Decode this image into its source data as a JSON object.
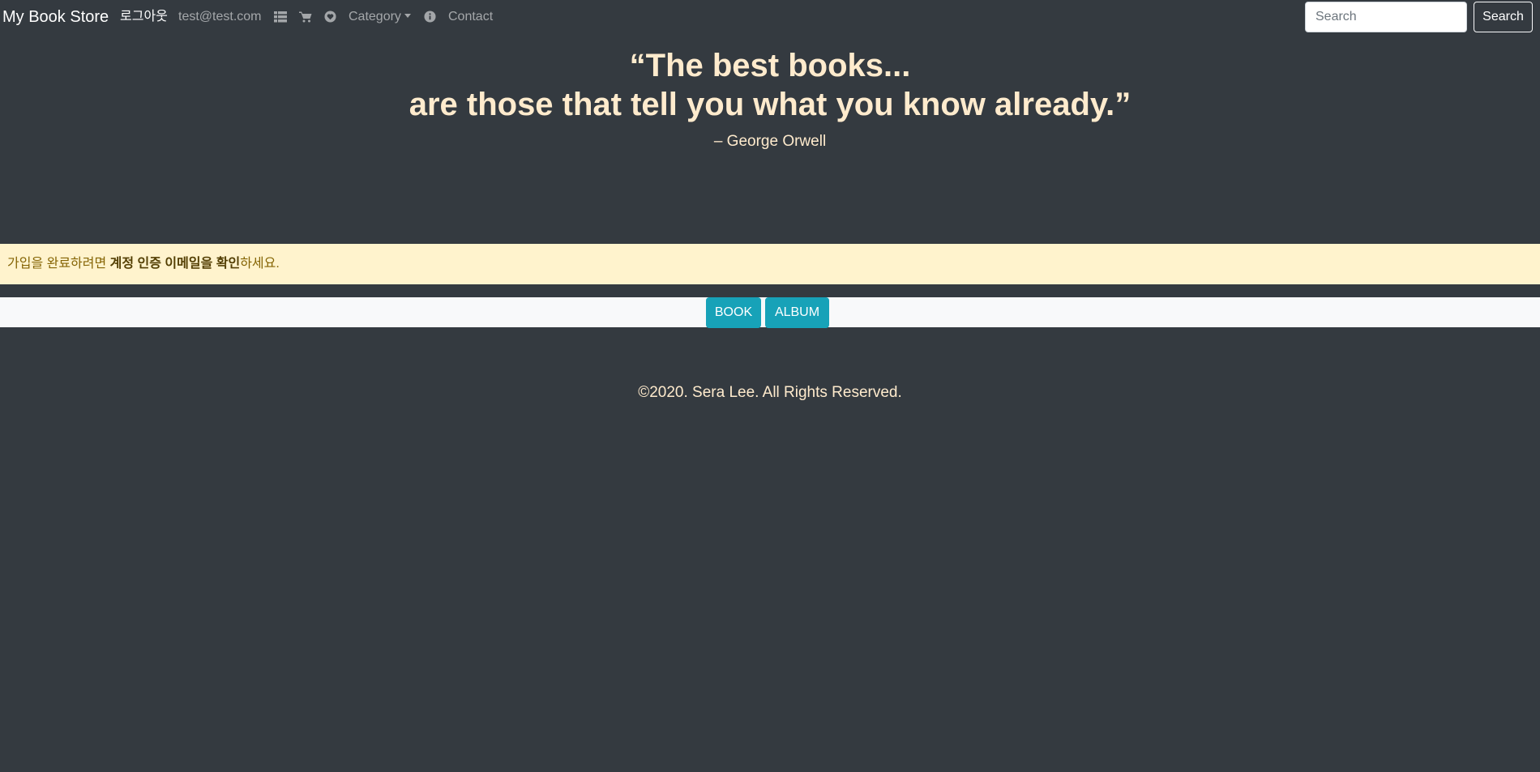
{
  "navbar": {
    "brand": "My Book Store",
    "logout": "로그아웃",
    "user_email": "test@test.com",
    "icons": [
      "list-icon",
      "cart-icon",
      "heart-icon",
      "info-icon"
    ],
    "category": "Category",
    "contact": "Contact",
    "search_placeholder": "Search",
    "search_button": "Search"
  },
  "hero": {
    "quote_line1": "“The best books...",
    "quote_line2": "are those that tell you what you know already.”",
    "author": "– George Orwell"
  },
  "alert": {
    "prefix": "가입을 완료하려면 ",
    "bold": "계정 인증 이메일을 확인",
    "suffix": "하세요."
  },
  "tabs": [
    "BOOK",
    "ALBUM"
  ],
  "footer": {
    "copyright": "©2020. Sera Lee. All Rights Reserved."
  },
  "colors": {
    "background": "#343a40",
    "accent": "#17a2b8",
    "quote_text": "#ffebcd",
    "alert_bg": "#fff3cd",
    "alert_text": "#856404"
  }
}
